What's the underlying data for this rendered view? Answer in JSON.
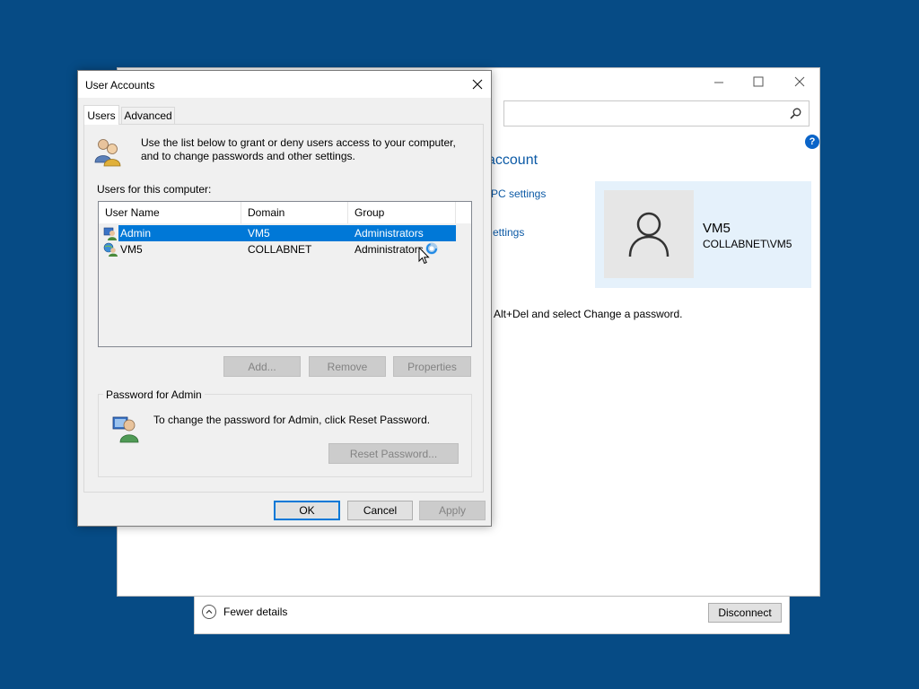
{
  "background_window": {
    "controls": [
      "minimize-icon",
      "maximize-icon",
      "close-icon"
    ],
    "account_title": "account",
    "link_pc_settings": "PC settings",
    "link_settings": "ettings",
    "ctrl_alt_del_text": "Alt+Del and select Change a password.",
    "user_card": {
      "name": "VM5",
      "domain": "COLLABNET\\VM5"
    },
    "help_icon": "?"
  },
  "bottom_panel": {
    "fewer_details": "Fewer details",
    "disconnect": "Disconnect"
  },
  "dialog": {
    "title": "User Accounts",
    "tabs": [
      {
        "label": "Users",
        "active": true
      },
      {
        "label": "Advanced",
        "active": false
      }
    ],
    "intro": "Use the list below to grant or deny users access to your computer, and to change passwords and other settings.",
    "users_label": "Users for this computer:",
    "columns": [
      "User Name",
      "Domain",
      "Group"
    ],
    "rows": [
      {
        "user": "Admin",
        "domain": "VM5",
        "group": "Administrators",
        "selected": true
      },
      {
        "user": "VM5",
        "domain": "COLLABNET",
        "group": "Administrators",
        "selected": false
      }
    ],
    "buttons": {
      "add": "Add...",
      "remove": "Remove",
      "properties": "Properties"
    },
    "password_group": {
      "label": "Password for Admin",
      "text": "To change the password for Admin, click Reset Password.",
      "reset": "Reset Password..."
    },
    "footer": {
      "ok": "OK",
      "cancel": "Cancel",
      "apply": "Apply"
    }
  },
  "colors": {
    "desktop": "#064b85",
    "selection": "#0078d7",
    "link": "#0c5aa6",
    "card": "#e5f1fb"
  }
}
